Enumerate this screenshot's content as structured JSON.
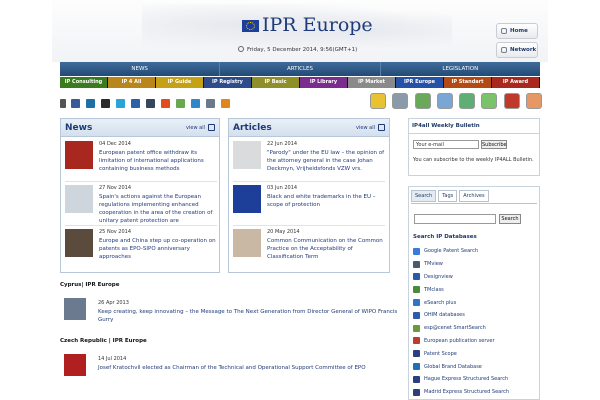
{
  "header": {
    "logo_text": "IPR Europe",
    "datetime": "Friday, 5 December 2014, 9:56(GMT+1)",
    "home_label": "Home",
    "network_label": "Network"
  },
  "nav": {
    "main": [
      "NEWS",
      "ARTICLES",
      "LEGISLATION"
    ],
    "sub": [
      {
        "label": "IP Consulting",
        "color": "#3a7b1f"
      },
      {
        "label": "IP 4 All",
        "color": "#b8861a"
      },
      {
        "label": "IP Guide",
        "color": "#c5a114"
      },
      {
        "label": "IP Registry",
        "color": "#2e4b8c"
      },
      {
        "label": "IP Basic",
        "color": "#8f8f2a"
      },
      {
        "label": "IP Library",
        "color": "#7a2d8f"
      },
      {
        "label": "IP Market",
        "color": "#8a8a8a"
      },
      {
        "label": "IPR Europe",
        "color": "#2552a8"
      },
      {
        "label": "IP Standart",
        "color": "#b34a14"
      },
      {
        "label": "IP Award",
        "color": "#a8281f"
      }
    ]
  },
  "social_icons": [
    "facebook-icon",
    "linkedin-icon",
    "delicious-icon",
    "twitter-icon",
    "digg-icon",
    "tumblr-icon",
    "stumble-icon",
    "share-icon",
    "email-icon",
    "print-icon",
    "rss-icon"
  ],
  "tool_icons": [
    {
      "name": "copyright-icon",
      "color": "#e8c233"
    },
    {
      "name": "magnifier-icon",
      "color": "#8a9aa8"
    },
    {
      "name": "trademark-icon",
      "color": "#6aa85a"
    },
    {
      "name": "patent-icon",
      "color": "#7aa6d6"
    },
    {
      "name": "design-cube-icon",
      "color": "#5fae74"
    },
    {
      "name": "globe-icon",
      "color": "#7ac36a"
    },
    {
      "name": "gear-icon",
      "color": "#c0392b"
    },
    {
      "name": "tools-icon",
      "color": "#e59866"
    }
  ],
  "news": {
    "title": "News",
    "viewall": "view all",
    "items": [
      {
        "date": "04 Dec 2014",
        "text": "European patent office withdraw its limitation of international applications containing business methods",
        "thumb": "#a8281f"
      },
      {
        "date": "27 Nov 2014",
        "text": "Spain's actions against the European regulations implementing enhanced cooperation in the area of the creation of unitary patent protection are",
        "thumb": "#cfd5dc"
      },
      {
        "date": "25 Nov 2014",
        "text": "Europe and China step up co-operation on patents as EPO-SIPO anniversary approaches",
        "thumb": "#5a4b3d"
      }
    ]
  },
  "articles": {
    "title": "Articles",
    "viewall": "view all",
    "items": [
      {
        "date": "22 Jun 2014",
        "text": "\"Parody\" under the EU law – the opinion of the attorney general in the case Johan Deckmyn, Vrijheidsfonds VZW vrs.",
        "thumb": "#d9dbdd"
      },
      {
        "date": "03 Jun 2014",
        "text": "Black and white trademarks in the EU – scope of protection",
        "thumb": "#1d3f9a"
      },
      {
        "date": "20 May 2014",
        "text": "Common Communication on the Common Practice on the Acceptability of Classification Term",
        "thumb": "#c9b8a3"
      }
    ]
  },
  "country_news": [
    {
      "country": "Cyprus| IPR Europe",
      "date": "26 Apr 2013",
      "text": "Keep creating, keep innovating – the Message to The Next Generation from Director General of WIPO Francis Gurry",
      "thumb": "#6b7a8f"
    },
    {
      "country": "Czech Republic | IPR Europe",
      "date": "14 Jul 2014",
      "text": "Josef Kratochvíl elected as Chairman of the Technical and Operational Support Committee of EPO",
      "thumb": "#b02020"
    }
  ],
  "bulletin": {
    "title": "IP4all Weekly Bulletin",
    "email_value": "Your e-mail",
    "subscribe": "Subscribe",
    "note": "You can subscribe to the weekly IP4ALL Bulletin."
  },
  "search": {
    "tabs": [
      "Search",
      "Tags",
      "Archives"
    ],
    "button": "Search",
    "db_title": "Search IP Databases",
    "databases": [
      {
        "label": "Google Patent Search",
        "color": "#3b7bd8"
      },
      {
        "label": "TMview",
        "color": "#4a5a6a"
      },
      {
        "label": "Designview",
        "color": "#2a5ba8"
      },
      {
        "label": "TMclass",
        "color": "#4b8a3a"
      },
      {
        "label": "eSearch plus",
        "color": "#2e74c8"
      },
      {
        "label": "OHIM databases",
        "color": "#2e5ca8"
      },
      {
        "label": "esp@cenet SmartSearch",
        "color": "#6a9a3a"
      },
      {
        "label": "European publication server",
        "color": "#c0392b"
      },
      {
        "label": "Patent Scope",
        "color": "#2c3e80"
      },
      {
        "label": "Global Brand Database",
        "color": "#1f6fb8"
      },
      {
        "label": "Hague Express Structured Search",
        "color": "#2c3e80"
      },
      {
        "label": "Madrid Express Structured Search",
        "color": "#2c3e80"
      }
    ]
  }
}
